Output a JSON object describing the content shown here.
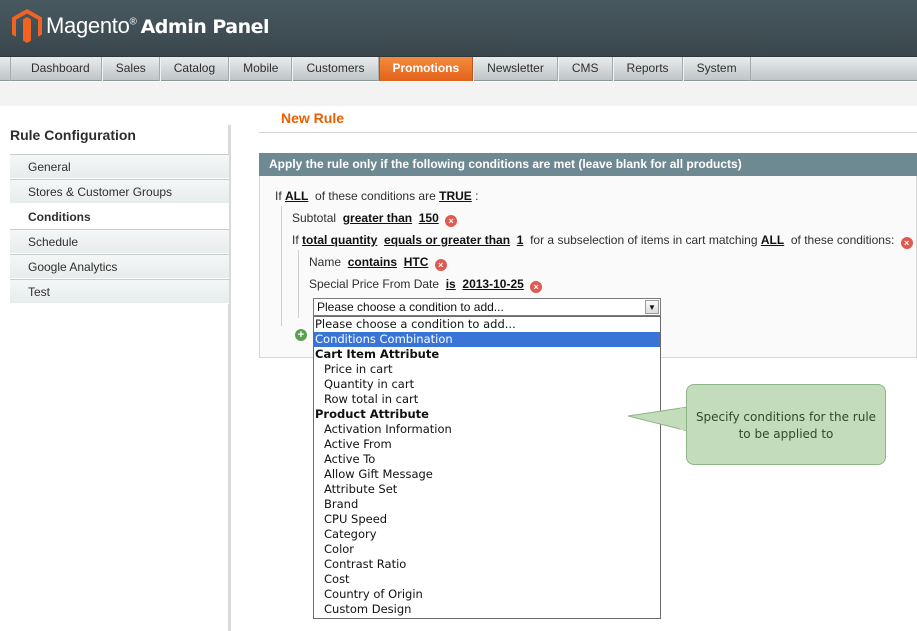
{
  "header": {
    "brand": "Magento",
    "trademark": "®",
    "subtitle": "Admin Panel"
  },
  "nav": {
    "items": [
      "Dashboard",
      "Sales",
      "Catalog",
      "Mobile",
      "Customers",
      "Promotions",
      "Newsletter",
      "CMS",
      "Reports",
      "System"
    ],
    "active": "Promotions"
  },
  "sidebar": {
    "title": "Rule Configuration",
    "tabs": [
      "General",
      "Stores & Customer Groups",
      "Conditions",
      "Schedule",
      "Google Analytics",
      "Test"
    ],
    "active_tab": "Conditions"
  },
  "main": {
    "title": "New Rule",
    "fieldset_title": "Apply the rule only if the following conditions are met (leave blank for all products)"
  },
  "conditions": {
    "root": {
      "if": "If",
      "aggregator": "ALL",
      "mid": "of these conditions are",
      "value": "TRUE",
      "colon": ":"
    },
    "subtotal": {
      "attr": "Subtotal",
      "op": "greater than",
      "value": "150"
    },
    "subselect": {
      "if": "If",
      "attr": "total quantity",
      "op": "equals or greater than",
      "value": "1",
      "mid": "for a subselection of items in cart matching",
      "aggregator": "ALL",
      "end": "of these conditions:"
    },
    "name": {
      "attr": "Name",
      "op": "contains",
      "value": "HTC"
    },
    "special_price": {
      "attr": "Special Price From Date",
      "op": "is",
      "value": "2013-10-25"
    },
    "select_value": "Please choose a condition to add..."
  },
  "dropdown": {
    "options": [
      {
        "label": "Please choose a condition to add...",
        "kind": "plain"
      },
      {
        "label": "Conditions Combination",
        "kind": "selected"
      },
      {
        "label": "Cart Item Attribute",
        "kind": "group"
      },
      {
        "label": "Price in cart",
        "kind": "child"
      },
      {
        "label": "Quantity in cart",
        "kind": "child"
      },
      {
        "label": "Row total in cart",
        "kind": "child"
      },
      {
        "label": "Product Attribute",
        "kind": "group"
      },
      {
        "label": "Activation Information",
        "kind": "child"
      },
      {
        "label": "Active From",
        "kind": "child"
      },
      {
        "label": "Active To",
        "kind": "child"
      },
      {
        "label": "Allow Gift Message",
        "kind": "child"
      },
      {
        "label": "Attribute Set",
        "kind": "child"
      },
      {
        "label": "Brand",
        "kind": "child"
      },
      {
        "label": "CPU Speed",
        "kind": "child"
      },
      {
        "label": "Category",
        "kind": "child"
      },
      {
        "label": "Color",
        "kind": "child"
      },
      {
        "label": "Contrast Ratio",
        "kind": "child"
      },
      {
        "label": "Cost",
        "kind": "child"
      },
      {
        "label": "Country of Origin",
        "kind": "child"
      },
      {
        "label": "Custom Design",
        "kind": "child"
      }
    ]
  },
  "callout": {
    "text_line1": "Specify conditions for the rule",
    "text_line2": "to be applied to"
  },
  "icons": {
    "delete": "remove-circle-icon",
    "add": "add-circle-icon",
    "logo": "magento-logo-icon"
  },
  "colors": {
    "accent": "#eb5e00",
    "nav_active": "#e4621b",
    "fieldset_header": "#6f8992",
    "selection": "#3875d7",
    "callout": "#c2dcbc"
  }
}
